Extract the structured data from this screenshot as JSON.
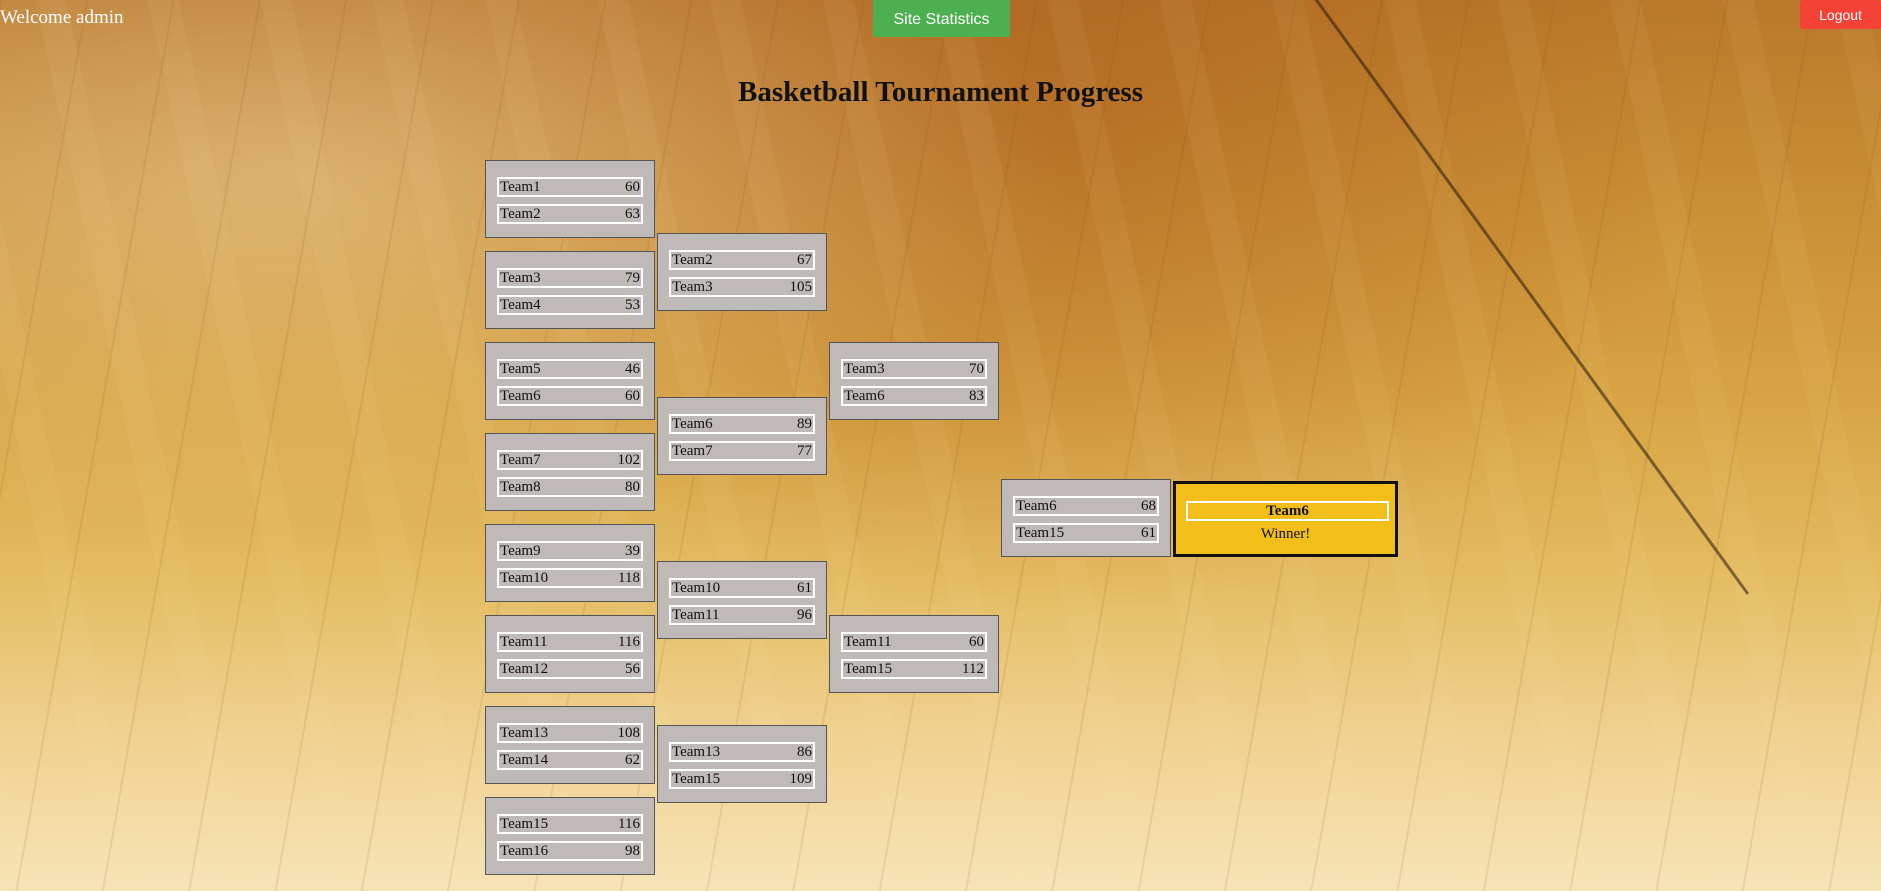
{
  "header": {
    "welcome_text": "Welcome admin",
    "stats_button": "Site Statistics",
    "logout_button": "Logout"
  },
  "page_title": "Basketball Tournament Progress",
  "colors": {
    "stats_button": "#4caf50",
    "logout_button": "#f44336",
    "match_box": "#bfb9b7",
    "winner_box": "#f2be1a"
  },
  "bracket": {
    "round1": [
      {
        "team1": "Team1",
        "score1": "60",
        "team2": "Team2",
        "score2": "63"
      },
      {
        "team1": "Team3",
        "score1": "79",
        "team2": "Team4",
        "score2": "53"
      },
      {
        "team1": "Team5",
        "score1": "46",
        "team2": "Team6",
        "score2": "60"
      },
      {
        "team1": "Team7",
        "score1": "102",
        "team2": "Team8",
        "score2": "80"
      },
      {
        "team1": "Team9",
        "score1": "39",
        "team2": "Team10",
        "score2": "118"
      },
      {
        "team1": "Team11",
        "score1": "116",
        "team2": "Team12",
        "score2": "56"
      },
      {
        "team1": "Team13",
        "score1": "108",
        "team2": "Team14",
        "score2": "62"
      },
      {
        "team1": "Team15",
        "score1": "116",
        "team2": "Team16",
        "score2": "98"
      }
    ],
    "round2": [
      {
        "team1": "Team2",
        "score1": "67",
        "team2": "Team3",
        "score2": "105"
      },
      {
        "team1": "Team6",
        "score1": "89",
        "team2": "Team7",
        "score2": "77"
      },
      {
        "team1": "Team10",
        "score1": "61",
        "team2": "Team11",
        "score2": "96"
      },
      {
        "team1": "Team13",
        "score1": "86",
        "team2": "Team15",
        "score2": "109"
      }
    ],
    "round3": [
      {
        "team1": "Team3",
        "score1": "70",
        "team2": "Team6",
        "score2": "83"
      },
      {
        "team1": "Team11",
        "score1": "60",
        "team2": "Team15",
        "score2": "112"
      }
    ],
    "final": [
      {
        "team1": "Team6",
        "score1": "68",
        "team2": "Team15",
        "score2": "61"
      }
    ],
    "champion": {
      "name": "Team6",
      "label": "Winner!"
    }
  }
}
